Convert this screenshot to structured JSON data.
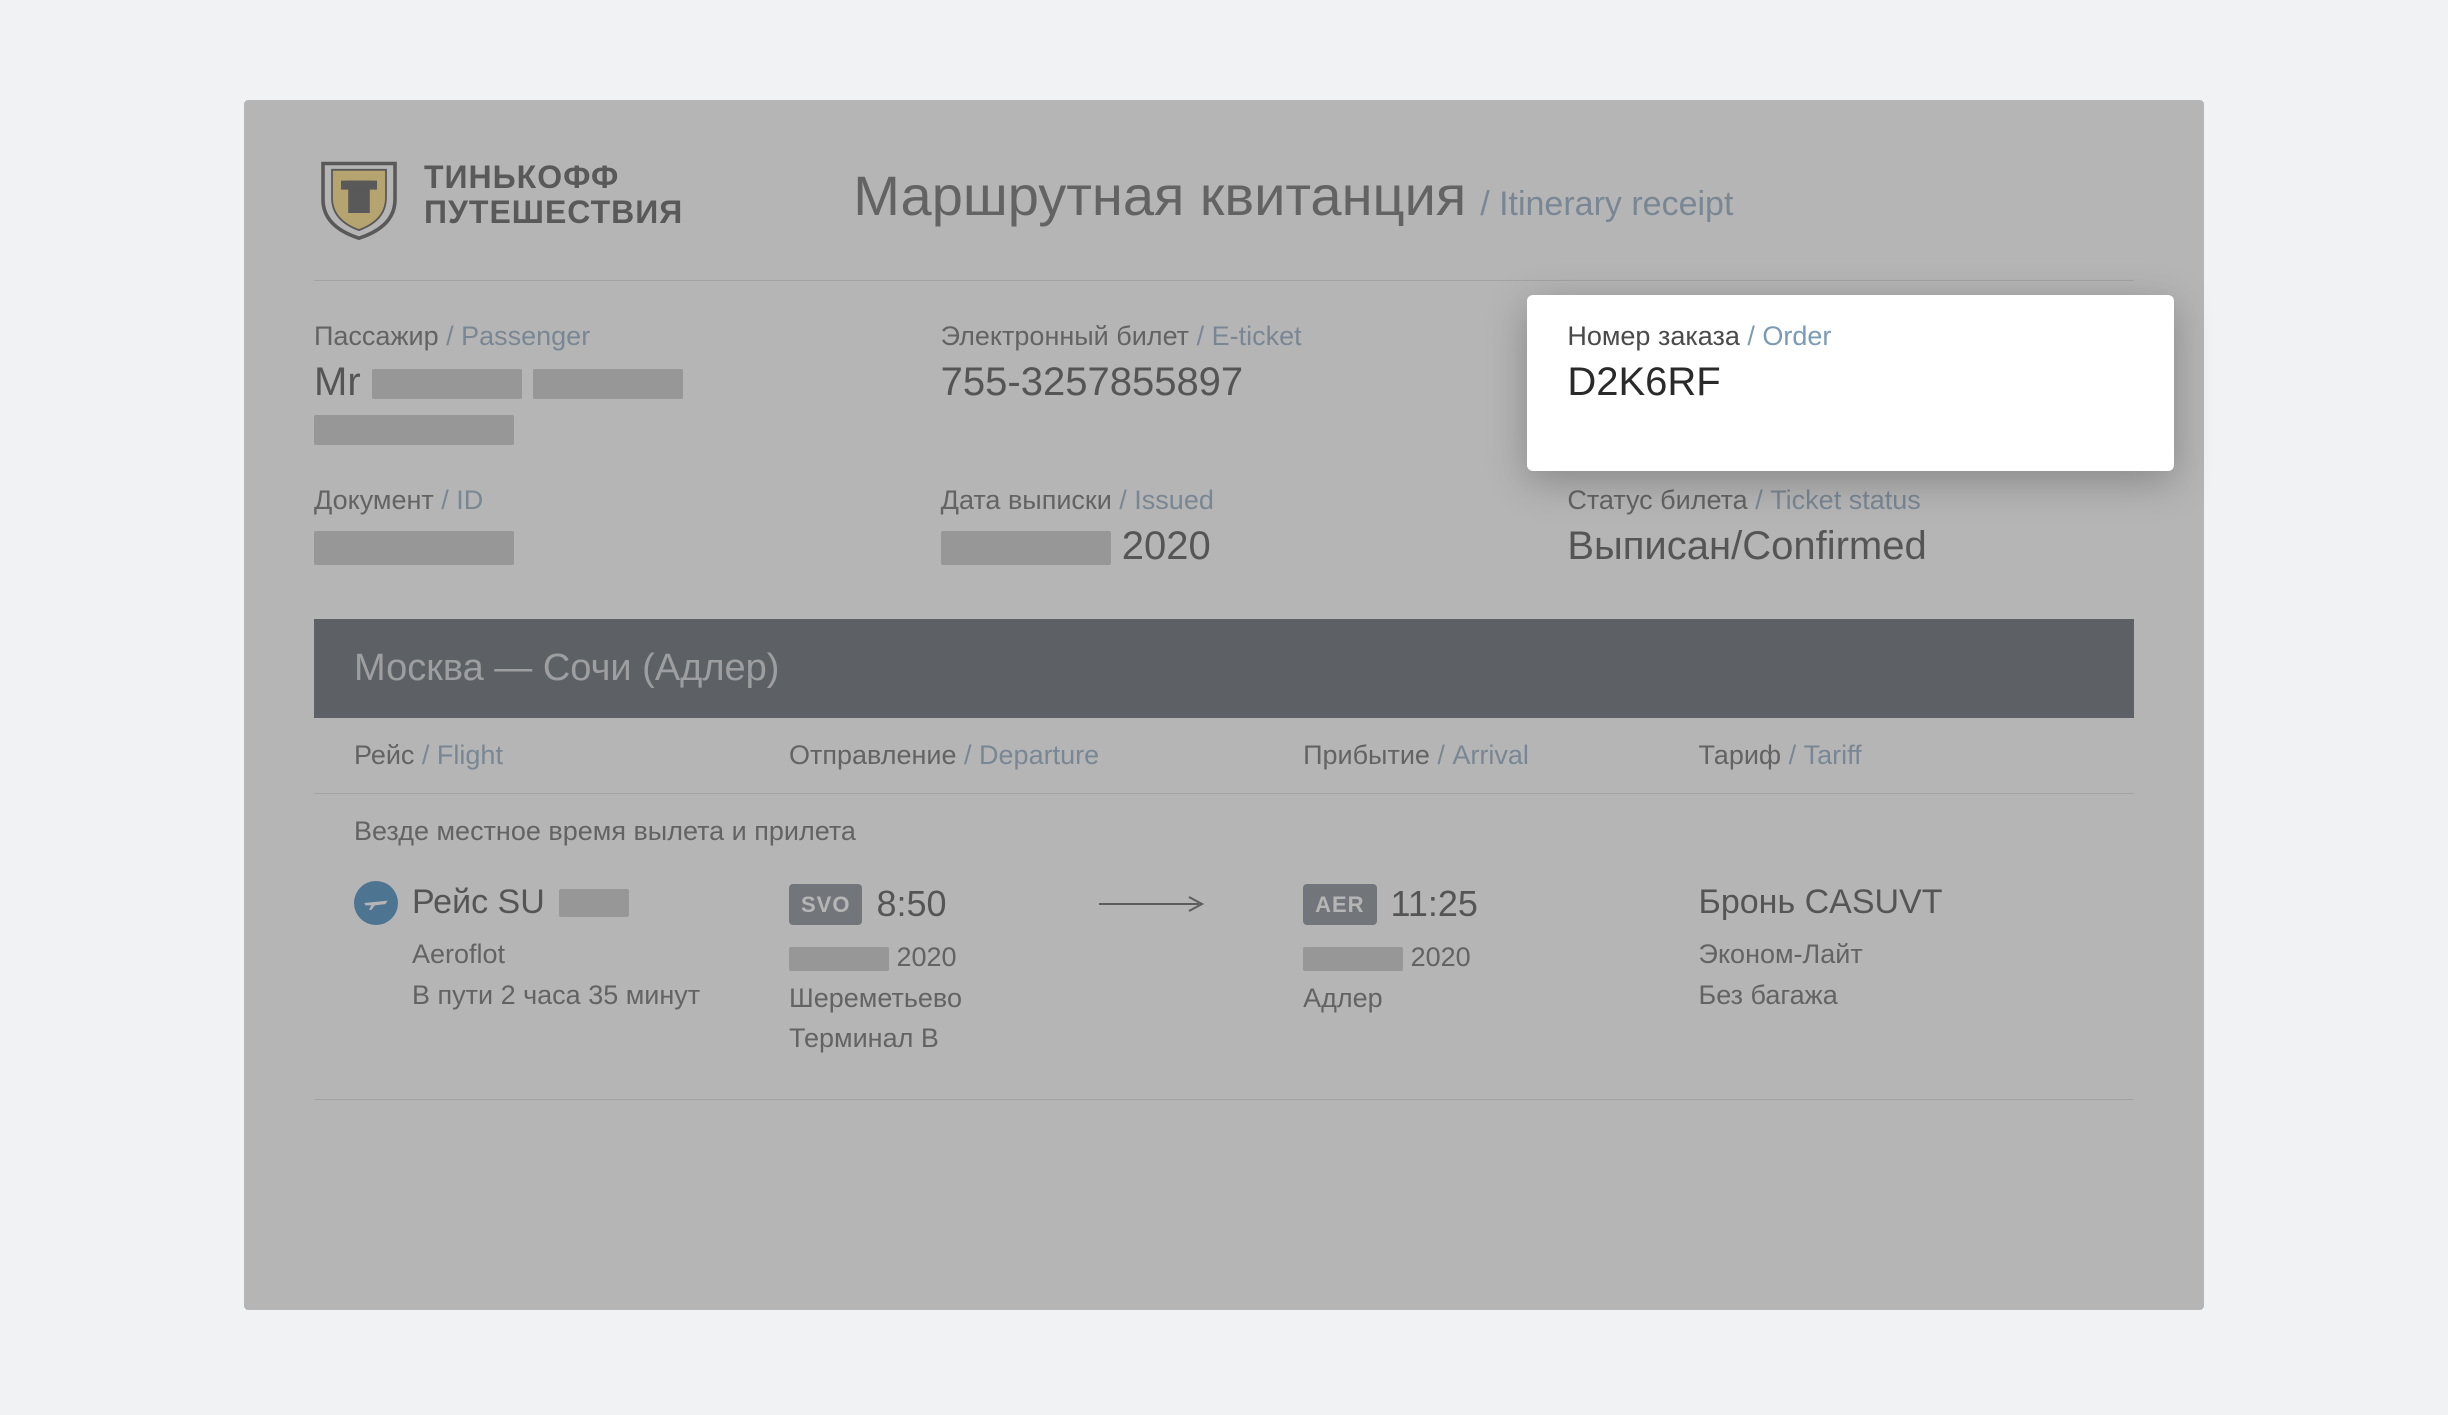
{
  "brand": {
    "line1": "ТИНЬКОФФ",
    "line2": "ПУТЕШЕСТВИЯ"
  },
  "title": {
    "ru": "Маршрутная квитанция",
    "en": "/ Itinerary receipt"
  },
  "fields": {
    "passenger": {
      "ru": "Пассажир ",
      "en": "/ Passenger",
      "value_prefix": "Mr"
    },
    "eticket": {
      "ru": "Электронный билет ",
      "en": "/ E-ticket",
      "value": "755-3257855897"
    },
    "order": {
      "ru": "Номер заказа ",
      "en": "/ Order",
      "value": "D2K6RF"
    },
    "document": {
      "ru": "Документ  ",
      "en": "/ ID"
    },
    "issued": {
      "ru": "Дата выписки  ",
      "en": "/ Issued",
      "year": " 2020"
    },
    "status": {
      "ru": "Статус билета  ",
      "en": "/ Ticket status",
      "value": "Выписан/Confirmed"
    }
  },
  "route": "Москва  —  Сочи  (Адлер)",
  "columns": {
    "flight": {
      "ru": "Рейс ",
      "en": "/ Flight"
    },
    "departure": {
      "ru": "Отправление ",
      "en": "/ Departure"
    },
    "arrival": {
      "ru": "Прибытие ",
      "en": "/ Arrival"
    },
    "tariff": {
      "ru": "Тариф  ",
      "en": "/ Tariff"
    }
  },
  "notice": "Везде местное время вылета и прилета",
  "flight": {
    "number_prefix": "Рейс SU",
    "airline": "Aeroflot",
    "duration": "В пути 2 часа 35 минут",
    "dep": {
      "code": "SVO",
      "time": "8:50",
      "year": " 2020",
      "airport": "Шереметьево",
      "terminal": "Терминал B"
    },
    "arr": {
      "code": "AER",
      "time": "11:25",
      "year": " 2020",
      "airport": "Адлер"
    },
    "tariff": {
      "booking": "Бронь CASUVT",
      "class": "Эконом-Лайт",
      "baggage": "Без багажа"
    }
  }
}
